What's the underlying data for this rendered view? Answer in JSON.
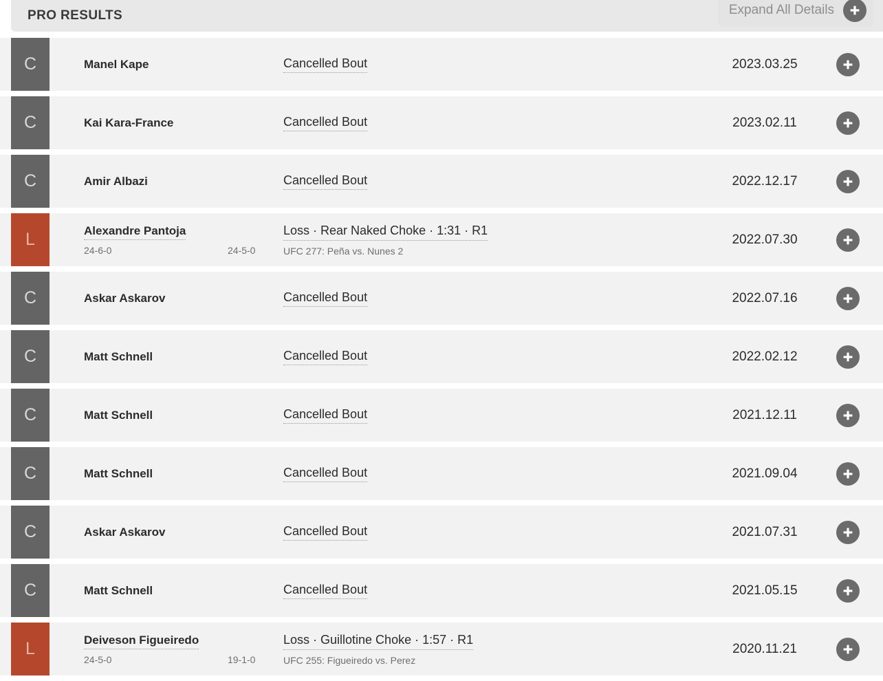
{
  "header": {
    "title": "PRO RESULTS",
    "expand_all_label": "Expand All Details",
    "expand_all_icon": "plus-icon"
  },
  "colors": {
    "cancelled_badge": "#646464",
    "loss_badge": "#b5472d",
    "row_background": "#f2f2f2",
    "header_background": "#e8e8e8",
    "plus_circle": "#6b6b6b"
  },
  "results": [
    {
      "badge": "C",
      "badge_type": "cancelled",
      "opponent": "Manel Kape",
      "opponent_linked": false,
      "record_self": "",
      "record_opponent": "",
      "outcome": "Cancelled Bout",
      "event": "",
      "date": "2023.03.25",
      "expand_icon": "plus-icon"
    },
    {
      "badge": "C",
      "badge_type": "cancelled",
      "opponent": "Kai Kara-France",
      "opponent_linked": false,
      "record_self": "",
      "record_opponent": "",
      "outcome": "Cancelled Bout",
      "event": "",
      "date": "2023.02.11",
      "expand_icon": "plus-icon"
    },
    {
      "badge": "C",
      "badge_type": "cancelled",
      "opponent": "Amir Albazi",
      "opponent_linked": false,
      "record_self": "",
      "record_opponent": "",
      "outcome": "Cancelled Bout",
      "event": "",
      "date": "2022.12.17",
      "expand_icon": "plus-icon"
    },
    {
      "badge": "L",
      "badge_type": "loss",
      "opponent": "Alexandre Pantoja",
      "opponent_linked": true,
      "record_self": "24-6-0",
      "record_opponent": "24-5-0",
      "outcome": "Loss · Rear Naked Choke · 1:31 · R1",
      "event": "UFC 277: Peña vs. Nunes 2",
      "date": "2022.07.30",
      "expand_icon": "plus-icon"
    },
    {
      "badge": "C",
      "badge_type": "cancelled",
      "opponent": "Askar Askarov",
      "opponent_linked": false,
      "record_self": "",
      "record_opponent": "",
      "outcome": "Cancelled Bout",
      "event": "",
      "date": "2022.07.16",
      "expand_icon": "plus-icon"
    },
    {
      "badge": "C",
      "badge_type": "cancelled",
      "opponent": "Matt Schnell",
      "opponent_linked": false,
      "record_self": "",
      "record_opponent": "",
      "outcome": "Cancelled Bout",
      "event": "",
      "date": "2022.02.12",
      "expand_icon": "plus-icon"
    },
    {
      "badge": "C",
      "badge_type": "cancelled",
      "opponent": "Matt Schnell",
      "opponent_linked": false,
      "record_self": "",
      "record_opponent": "",
      "outcome": "Cancelled Bout",
      "event": "",
      "date": "2021.12.11",
      "expand_icon": "plus-icon"
    },
    {
      "badge": "C",
      "badge_type": "cancelled",
      "opponent": "Matt Schnell",
      "opponent_linked": false,
      "record_self": "",
      "record_opponent": "",
      "outcome": "Cancelled Bout",
      "event": "",
      "date": "2021.09.04",
      "expand_icon": "plus-icon"
    },
    {
      "badge": "C",
      "badge_type": "cancelled",
      "opponent": "Askar Askarov",
      "opponent_linked": false,
      "record_self": "",
      "record_opponent": "",
      "outcome": "Cancelled Bout",
      "event": "",
      "date": "2021.07.31",
      "expand_icon": "plus-icon"
    },
    {
      "badge": "C",
      "badge_type": "cancelled",
      "opponent": "Matt Schnell",
      "opponent_linked": false,
      "record_self": "",
      "record_opponent": "",
      "outcome": "Cancelled Bout",
      "event": "",
      "date": "2021.05.15",
      "expand_icon": "plus-icon"
    },
    {
      "badge": "L",
      "badge_type": "loss",
      "opponent": "Deiveson Figueiredo",
      "opponent_linked": true,
      "record_self": "24-5-0",
      "record_opponent": "19-1-0",
      "outcome": "Loss · Guillotine Choke · 1:57 · R1",
      "event": "UFC 255: Figueiredo vs. Perez",
      "date": "2020.11.21",
      "expand_icon": "plus-icon"
    }
  ]
}
